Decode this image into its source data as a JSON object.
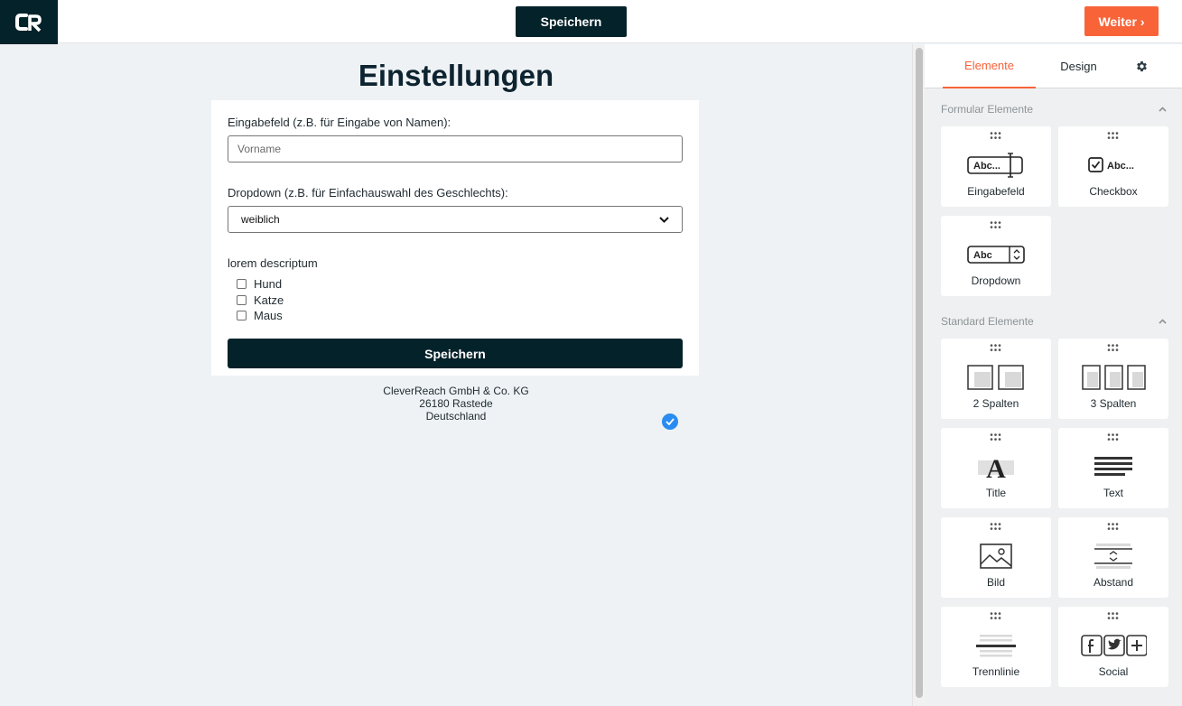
{
  "topbar": {
    "logo_text": "CR",
    "save_label": "Speichern",
    "next_label": "Weiter ›"
  },
  "page": {
    "title": "Einstellungen",
    "input": {
      "label": "Eingabefeld (z.B. für Eingabe von Namen):",
      "placeholder": "Vorname"
    },
    "dropdown": {
      "label": "Dropdown (z.B. für Einfachauswahl des Geschlechts):",
      "value": "weiblich"
    },
    "checkbox_group": {
      "label": "lorem descriptum",
      "options": [
        "Hund",
        "Katze",
        "Maus"
      ]
    },
    "submit_label": "Speichern",
    "footer": [
      "CleverReach GmbH & Co. KG",
      "26180 Rastede",
      "Deutschland"
    ]
  },
  "sidebar": {
    "tabs": [
      "Elemente",
      "Design"
    ],
    "active_tab": "Elemente",
    "settings_icon": "gear-icon",
    "sections": [
      {
        "title": "Formular Elemente",
        "items": [
          "Eingabefeld",
          "Checkbox",
          "Dropdown"
        ]
      },
      {
        "title": "Standard Elemente",
        "items": [
          "2 Spalten",
          "3 Spalten",
          "Title",
          "Text",
          "Bild",
          "Abstand",
          "Trennlinie",
          "Social"
        ]
      }
    ],
    "icon_texts": {
      "input": "Abc...",
      "checkbox": "Abc...",
      "dropdown": "Abc",
      "title": "A"
    }
  },
  "colors": {
    "accent": "#f86338",
    "dark": "#04222a",
    "badge": "#2a8cf0",
    "canvas_bg": "#eef2f5"
  }
}
